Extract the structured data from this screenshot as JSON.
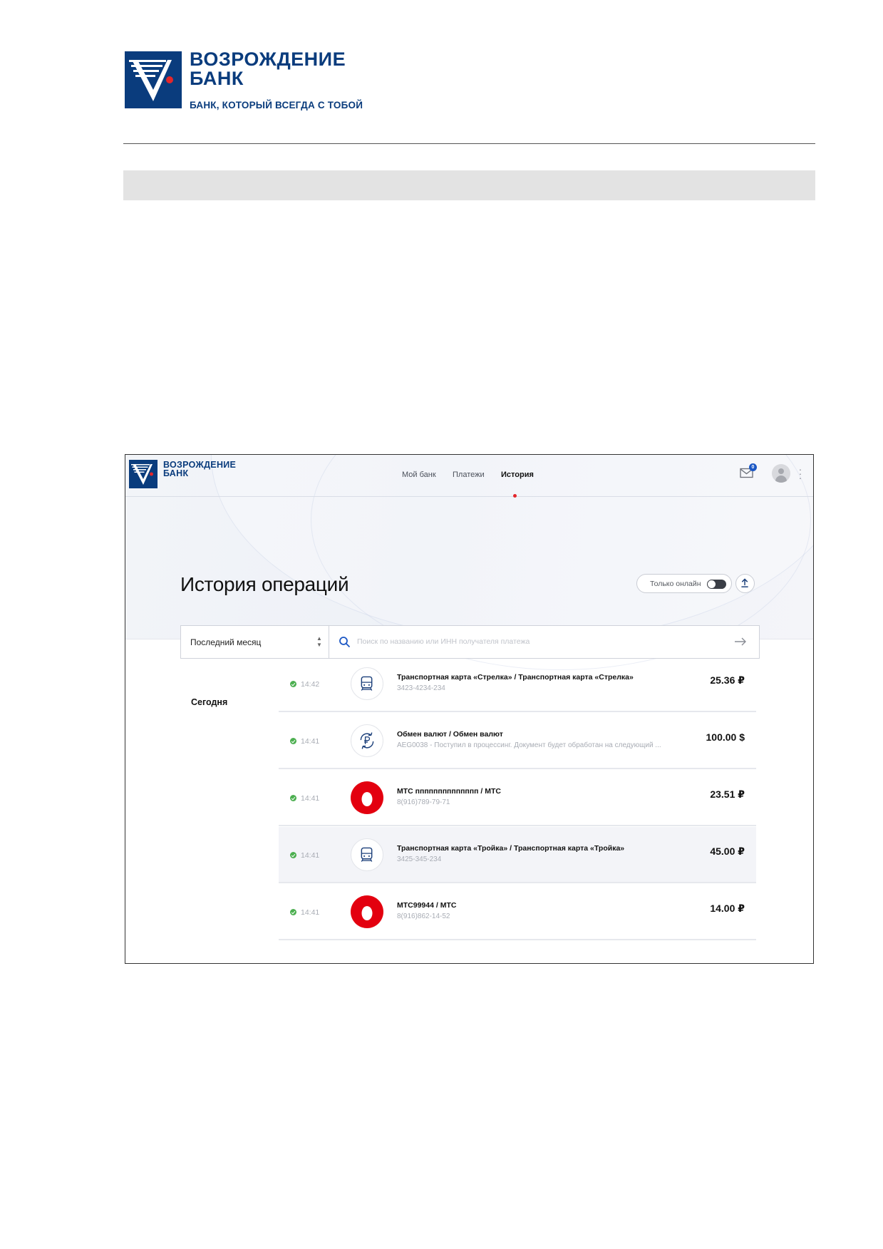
{
  "document": {
    "brand_name_line1": "ВОЗРОЖДЕНИЕ",
    "brand_name_line2": "БАНК",
    "slogan": "БАНК, КОТОРЫЙ ВСЕГДА С ТОБОЙ"
  },
  "app": {
    "brand_line1": "ВОЗРОЖДЕНИЕ",
    "brand_line2": "БАНК",
    "nav": [
      {
        "label": "Мой банк",
        "active": false
      },
      {
        "label": "Платежи",
        "active": false
      },
      {
        "label": "История",
        "active": true
      }
    ],
    "mail_badge": "0",
    "page_title": "История операций",
    "online_toggle_label": "Только онлайн",
    "online_toggle_on": false,
    "filter": {
      "period": "Последний месяц",
      "search_placeholder": "Поиск по названию или ИНН получателя платежа"
    },
    "day_label": "Сегодня",
    "transactions": [
      {
        "time": "14:42",
        "icon": "train-icon",
        "title": "Транспортная карта «Стрелка» / Транспортная карта «Стрелка»",
        "subtitle": "3423-4234-234",
        "amount": "25.36 ₽",
        "highlighted": false
      },
      {
        "time": "14:41",
        "icon": "currency-exchange-icon",
        "title": "Обмен валют / Обмен валют",
        "subtitle": "AEG0038 - Поступил в процессинг. Документ будет обработан на следующий ...",
        "amount": "100.00 $",
        "highlighted": false
      },
      {
        "time": "14:41",
        "icon": "mts-egg-icon",
        "title": "МТС пппппппппппппп / МТС",
        "subtitle": "8(916)789-79-71",
        "amount": "23.51 ₽",
        "highlighted": false
      },
      {
        "time": "14:41",
        "icon": "train-icon",
        "title": "Транспортная карта «Тройка» / Транспортная карта «Тройка»",
        "subtitle": "3425-345-234",
        "amount": "45.00 ₽",
        "highlighted": true
      },
      {
        "time": "14:41",
        "icon": "mts-egg-icon",
        "title": "МТС99944 / МТС",
        "subtitle": "8(916)862-14-52",
        "amount": "14.00 ₽",
        "highlighted": false
      }
    ],
    "colors": {
      "brand_blue": "#0a3c7d",
      "accent_red": "#e3262b",
      "mts_red": "#e3000f",
      "status_green": "#4caf50"
    }
  }
}
